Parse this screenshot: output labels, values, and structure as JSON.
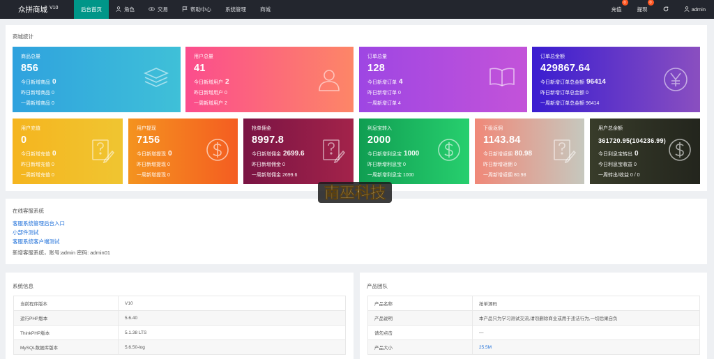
{
  "app": {
    "name": "众拼商城",
    "version": "V10"
  },
  "nav": [
    {
      "label": "后台首页",
      "icon": "home",
      "active": true
    },
    {
      "label": "角色",
      "icon": "user-icon",
      "active": false
    },
    {
      "label": "交易",
      "icon": "eye-icon",
      "active": false
    },
    {
      "label": "帮助中心",
      "icon": "flag-icon",
      "active": false
    },
    {
      "label": "系统管理",
      "icon": "",
      "active": false
    },
    {
      "label": "商城",
      "icon": "",
      "active": false
    }
  ],
  "topright": {
    "recharge": {
      "label": "充值",
      "badge": "0"
    },
    "withdraw": {
      "label": "提现",
      "badge": "0"
    },
    "user": "admin"
  },
  "stats": {
    "title": "商城统计",
    "cards": [
      {
        "label": "商品总量",
        "value": "856",
        "l1k": "今日新增商品",
        "l1v": "0",
        "l2": "昨日新增商品 0",
        "l3": "一周新增商品 0",
        "color1": "#2fa2de",
        "color2": "#3fc0d8",
        "icon": "layers-icon"
      },
      {
        "label": "用户总量",
        "value": "41",
        "l1k": "今日新增用户",
        "l1v": "2",
        "l2": "昨日新增用户 0",
        "l3": "一周新增用户 2",
        "color1": "#fb4d8d",
        "color2": "#fd8667",
        "icon": "person-icon"
      },
      {
        "label": "订单总量",
        "value": "128",
        "l1k": "今日新增订单",
        "l1v": "4",
        "l2": "昨日新增订单 0",
        "l3": "一周新增订单 4",
        "color1": "#9e46e3",
        "color2": "#c353d9",
        "icon": "book-icon"
      },
      {
        "label": "订单总金额",
        "value": "429867.64",
        "l1k": "今日新增订单总金额",
        "l1v": "96414",
        "l2": "昨日新增订单总金额 0",
        "l3": "一周新增订单总金额 96414",
        "color1": "#3a1dd0",
        "color2": "#8a4fc0",
        "icon": "yen-icon"
      },
      {
        "label": "用户充值",
        "value": "0",
        "l1k": "今日新增充值",
        "l1v": "0",
        "l2": "昨日新增充值 0",
        "l3": "一周新增充值 0",
        "color1": "#f5b51f",
        "color2": "#f0c531",
        "icon": "edit-doc-icon"
      },
      {
        "label": "用户提现",
        "value": "7156",
        "l1k": "今日新增提现",
        "l1v": "0",
        "l2": "昨日新增提现 0",
        "l3": "一周新增提现 0",
        "color1": "#f4931f",
        "color2": "#f45d21",
        "icon": "dollar-icon"
      },
      {
        "label": "抢单佣金",
        "value": "8997.8",
        "l1k": "今日新增佣金",
        "l1v": "2699.6",
        "l2": "昨日新增佣金 0",
        "l3": "一周新增佣金 2699.6",
        "color1": "#7a1444",
        "color2": "#a3234a",
        "icon": "edit-doc-icon"
      },
      {
        "label": "利息宝转入",
        "value": "2000",
        "l1k": "今日新增利息宝",
        "l1v": "1000",
        "l2": "昨日新增利息宝 0",
        "l3": "一周新增利息宝 1000",
        "color1": "#109e52",
        "color2": "#27cf6e",
        "icon": "dollar-icon"
      },
      {
        "label": "下级返佣",
        "value": "1143.84",
        "l1k": "今日新增返佣",
        "l1v": "80.98",
        "l2": "昨日新增返佣 0",
        "l3": "一周新增返佣 80.98",
        "color1": "#f08878",
        "color2": "#c6c8be",
        "icon": "edit-doc-icon"
      },
      {
        "label": "用户总余额",
        "value": "361720.95(104236.99)",
        "l1k": "今日利息宝转出",
        "l1v": "0",
        "l2": "今日利息宝收益 0",
        "l3": "一周转出/收益 0 / 0",
        "color1": "#383c2a",
        "color2": "#23251d",
        "icon": "dollar-icon"
      }
    ]
  },
  "support": {
    "title": "在线客服系统",
    "links": [
      "客服系统管理后台入口",
      "小部件测试",
      "客服系统客户端测试"
    ],
    "note": "新增客服系统，账号:admin 密码: admin01"
  },
  "sysinfo": {
    "title": "系统信息",
    "rows": [
      [
        "当前程序版本",
        "V10"
      ],
      [
        "运行PHP版本",
        "5.6.40"
      ],
      [
        "ThinkPHP版本",
        "5.1.38 LTS"
      ],
      [
        "MySQL数据库版本",
        "5.6.50-log"
      ]
    ]
  },
  "team": {
    "title": "产品团队",
    "rows": [
      [
        "产品名称",
        "抢单源码"
      ],
      [
        "产品说明",
        "本产品只为学习测试交流,请勿删除商业或用于违法行为,一切后果自负"
      ],
      [
        "请勿点击",
        "—"
      ],
      [
        "产品大小",
        "25.5M"
      ]
    ]
  },
  "watermark": "南巫科技"
}
